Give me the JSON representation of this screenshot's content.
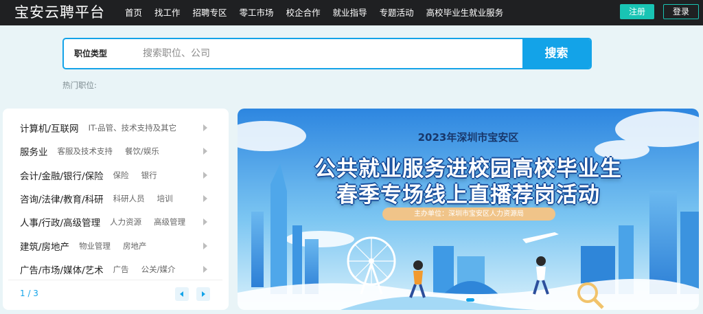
{
  "header": {
    "logo": "宝安云聘平台",
    "nav": [
      "首页",
      "找工作",
      "招聘专区",
      "零工市场",
      "校企合作",
      "就业指导",
      "专题活动",
      "高校毕业生就业服务"
    ],
    "register": "注册",
    "login": "登录"
  },
  "search": {
    "type_label": "职位类型",
    "placeholder": "搜索职位、公司",
    "button": "搜索",
    "hot_label": "热门职位:"
  },
  "categories": {
    "items": [
      {
        "name": "计算机/互联网",
        "subs": [
          "IT-品管、技术支持及其它"
        ]
      },
      {
        "name": "服务业",
        "subs": [
          "客服及技术支持",
          "餐饮/娱乐"
        ]
      },
      {
        "name": "会计/金融/银行/保险",
        "subs": [
          "保险",
          "银行"
        ]
      },
      {
        "name": "咨询/法律/教育/科研",
        "subs": [
          "科研人员",
          "培训"
        ]
      },
      {
        "name": "人事/行政/高级管理",
        "subs": [
          "人力资源",
          "高级管理"
        ]
      },
      {
        "name": "建筑/房地产",
        "subs": [
          "物业管理",
          "房地产"
        ]
      },
      {
        "name": "广告/市场/媒体/艺术",
        "subs": [
          "广告",
          "公关/媒介"
        ]
      }
    ],
    "pager": "1 / 3"
  },
  "banner": {
    "year_line": "2023年深圳市宝安区",
    "title_line1": "公共就业服务进校园高校毕业生",
    "title_line2": "春季专场线上直播荐岗活动",
    "organizer": "主办单位：深圳市宝安区人力资源局"
  },
  "colors": {
    "accent": "#13a3e8",
    "register": "#19c4b4",
    "topbar": "#1f2022",
    "page_bg": "#e9f4f7"
  }
}
